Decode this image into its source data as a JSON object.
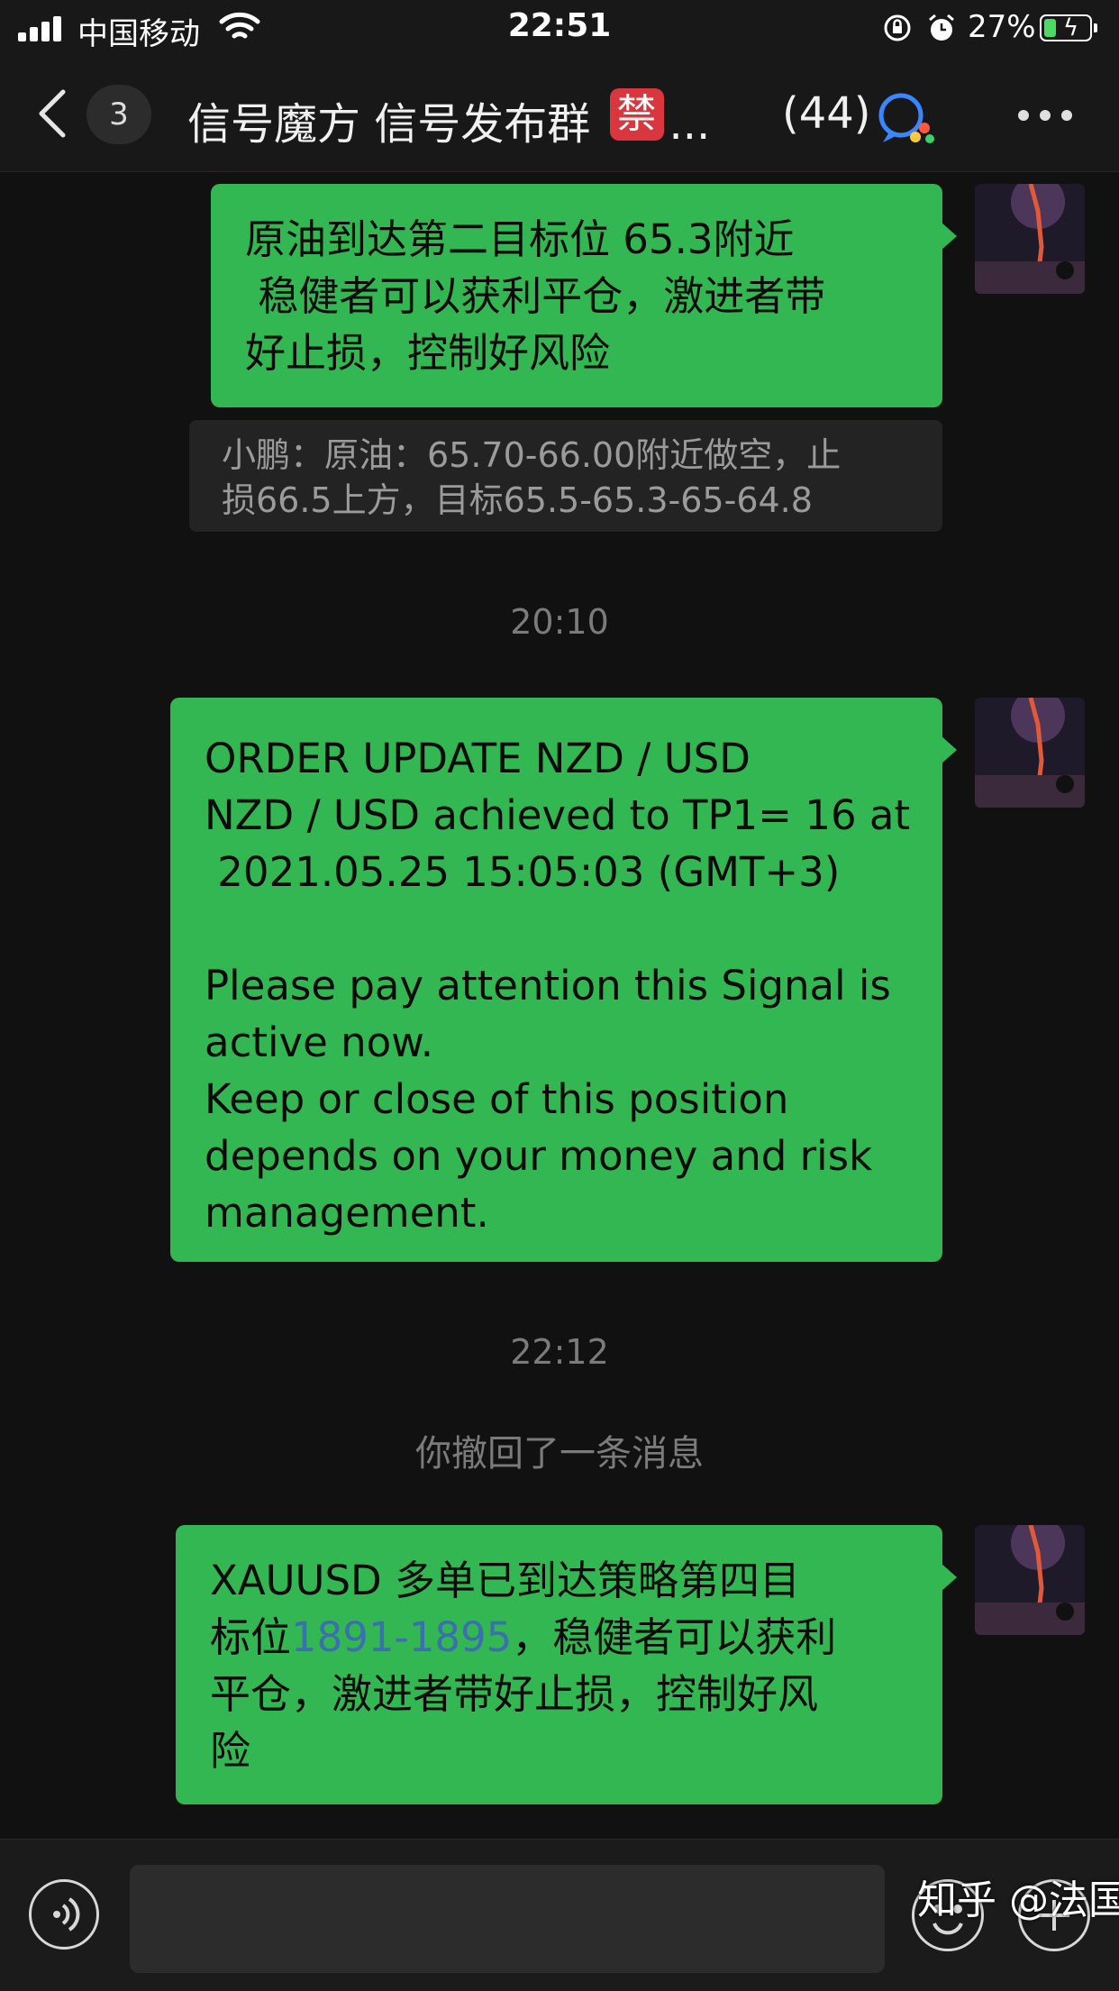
{
  "status_bar": {
    "carrier": "中国移动",
    "time": "22:51",
    "battery_percent": "27%",
    "battery_level": 0.27,
    "charging": true
  },
  "nav": {
    "unread_count": "3",
    "title": "信号魔方 信号发布群",
    "badge": "禁",
    "title_ellipsis": "...",
    "member_count": "(44)",
    "icons": [
      "back-icon",
      "qq-icon",
      "more-icon"
    ]
  },
  "messages": [
    {
      "type": "outgoing",
      "lines": [
        "原油到达第二目标位 65.3附近",
        " 稳健者可以获利平仓，激进者带",
        "好止损，控制好风险"
      ]
    },
    {
      "type": "quote",
      "lines": [
        "小鹏：原油：65.70-66.00附近做空，止",
        "损66.5上方，目标65.5-65.3-65-64.8"
      ]
    },
    {
      "type": "time",
      "text": "20:10"
    },
    {
      "type": "outgoing",
      "lines": [
        "ORDER UPDATE NZD / USD",
        "NZD / USD achieved to TP1= 16 at",
        " 2021.05.25 15:05:03 (GMT+3)",
        "",
        "Please pay attention this Signal is",
        "active now.",
        "Keep or close of this position",
        "depends on your money and risk",
        "management."
      ]
    },
    {
      "type": "time",
      "text": "22:12"
    },
    {
      "type": "system",
      "text": "你撤回了一条消息"
    },
    {
      "type": "outgoing",
      "line1": "XAUUSD 多单已到达策略第四目",
      "line2_prefix": "标位",
      "line2_link": "1891-1895",
      "line2_suffix": "，稳健者可以获利",
      "line3": "平仓，激进者带好止损，控制好风",
      "line4": "险"
    }
  ],
  "input_bar": {
    "icons": [
      "voice-icon",
      "emoji-icon",
      "plus-icon"
    ],
    "watermark": "知乎 @法国人"
  },
  "colors": {
    "bubble": "#32b752",
    "background": "#111111",
    "link": "#3b6fb0",
    "badge": "#d9363e"
  }
}
